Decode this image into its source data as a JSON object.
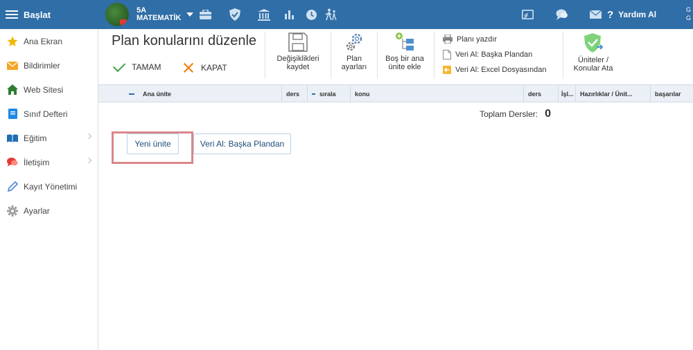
{
  "topbar": {
    "menu_label": "Başlat",
    "class_line1": "5A",
    "class_line2": "MATEMATİK",
    "help_label": "Yardım Al",
    "user_tag": "G G",
    "icons": [
      "briefcase-icon",
      "shield-icon",
      "bank-icon",
      "bar-chart-icon",
      "clock-icon",
      "people-walk-icon",
      "cast-icon",
      "chat-icon",
      "mail-icon"
    ]
  },
  "sidebar": {
    "items": [
      {
        "label": "Ana Ekran",
        "icon": "star-icon",
        "color": "#f2b705"
      },
      {
        "label": "Bildirimler",
        "icon": "mail-icon",
        "color": "#f5a623"
      },
      {
        "label": "Web Sitesi",
        "icon": "home-icon",
        "color": "#2e7d32"
      },
      {
        "label": "Sınıf Defteri",
        "icon": "notebook-icon",
        "color": "#1e88e5"
      },
      {
        "label": "Eğitim",
        "icon": "book-icon",
        "color": "#1e6fb4"
      },
      {
        "label": "İletişim",
        "icon": "chat-icon",
        "color": "#e53935"
      },
      {
        "label": "Kayıt Yönetimi",
        "icon": "pencil-icon",
        "color": "#5c8fd6"
      },
      {
        "label": "Ayarlar",
        "icon": "gear-icon",
        "color": "#9e9e9e"
      }
    ]
  },
  "main": {
    "title": "Plan konularını düzenle",
    "ok_label": "TAMAM",
    "close_label": "KAPAT",
    "save_line1": "Değişiklikleri",
    "save_line2": "kaydet",
    "settings_line1": "Plan",
    "settings_line2": "ayarları",
    "add_unit_line1": "Boş bir ana",
    "add_unit_line2": "ünite ekle",
    "print_label": "Planı yazdır",
    "import_plan_label": "Veri Al: Başka Plandan",
    "import_excel_label": "Veri Al: Excel Dosyasından",
    "assign_line1": "Üniteler /",
    "assign_line2": "Konular Ata",
    "columns": [
      "Ana ünite",
      "ders",
      "sırala",
      "konu",
      "ders",
      "İşl...",
      "Hazırlıklar / Ünit...",
      "başarılar"
    ],
    "total_label": "Toplam Dersler:",
    "total_value": "0",
    "new_unit_label": "Yeni ünite",
    "import_button_label": "Veri Al: Başka Plandan"
  },
  "colors": {
    "topbar": "#2f6ea7",
    "table_header": "#eaf0f6",
    "highlight": "#d9868a",
    "ok_green": "#43a047",
    "close_orange": "#f57c00"
  }
}
